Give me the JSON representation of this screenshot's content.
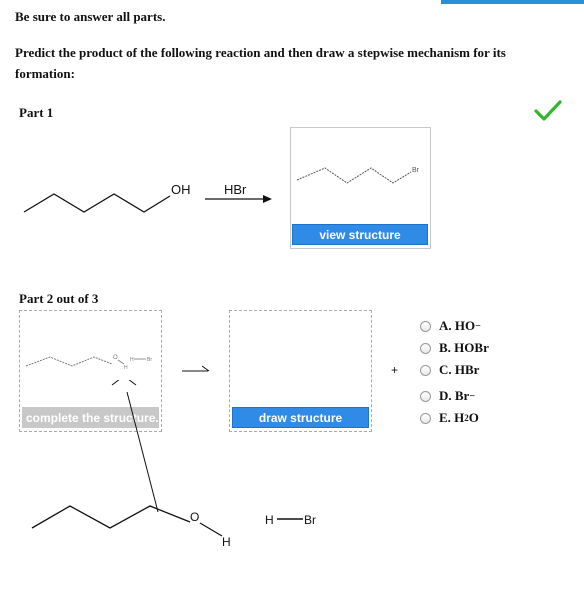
{
  "instructions": "Be sure to answer all parts.",
  "question": "Predict the product of the following reaction and then draw a stepwise mechanism for its formation:",
  "part1": {
    "label": "Part 1",
    "reactant_label": "OH",
    "reagent": "HBr",
    "product_label": "Br",
    "view_button": "view structure",
    "status_icon": "check-icon",
    "status_color": "#2fb82f"
  },
  "part2": {
    "label": "Part 2 out of 3",
    "complete_button": "complete the structure...",
    "draw_button": "draw structure",
    "plus": "+",
    "preview_labels": {
      "o": "O",
      "h": "H",
      "hbr_h": "H",
      "hbr_br": "Br"
    },
    "options": [
      {
        "letter": "A.",
        "main": "HO",
        "sup": "−",
        "sub": ""
      },
      {
        "letter": "B.",
        "main": "HOBr",
        "sup": "",
        "sub": ""
      },
      {
        "letter": "C.",
        "main": "HBr",
        "sup": "",
        "sub": ""
      },
      {
        "letter": "D.",
        "main": "Br",
        "sup": "−",
        "sub": ""
      },
      {
        "letter": "E.",
        "main": "H",
        "sup": "",
        "sub": "2",
        "after": "O"
      }
    ]
  },
  "bottom": {
    "o_label": "O",
    "h_label": "H",
    "hbr_h": "H",
    "hbr_br": "Br"
  },
  "colors": {
    "accent": "#2f8be6",
    "check": "#2fb82f"
  }
}
